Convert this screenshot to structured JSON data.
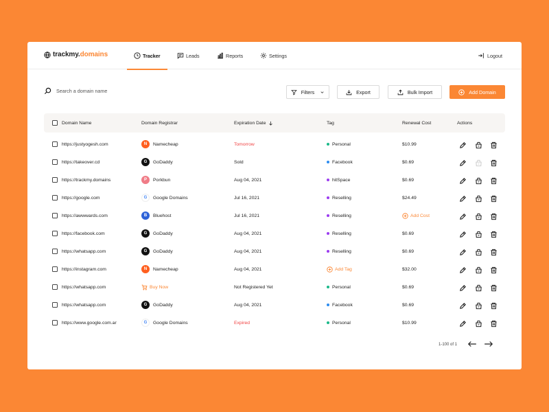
{
  "app": {
    "logo_part1": "trackmy.",
    "logo_part2": "domains"
  },
  "nav": {
    "tabs": [
      {
        "label": "Tracker",
        "icon": "clock-icon",
        "active": true
      },
      {
        "label": "Leads",
        "icon": "message-icon",
        "active": false
      },
      {
        "label": "Reports",
        "icon": "bar-chart-icon",
        "active": false
      },
      {
        "label": "Settings",
        "icon": "gear-icon",
        "active": false
      }
    ],
    "logout_label": "Logout"
  },
  "toolbar": {
    "search_placeholder": "Search a domain name",
    "filters_label": "Filters",
    "export_label": "Export",
    "bulk_import_label": "Bulk Import",
    "add_domain_label": "Add Domain"
  },
  "table": {
    "headers": {
      "domain": "Domain Name",
      "registrar": "Domain Registrar",
      "expiration": "Expiration Date",
      "tag": "Tag",
      "cost": "Renewal Cost",
      "actions": "Actions"
    },
    "rows": [
      {
        "domain": "https://justyogesh.com",
        "registrar": "Namecheap",
        "expiration": "Tomorrow",
        "tag": "Personal",
        "cost": "$10.99"
      },
      {
        "domain": "https://takeover.cd",
        "registrar": "GoDaddy",
        "expiration": "Sold",
        "tag": "Facebook",
        "cost": "$0.69"
      },
      {
        "domain": "https://trackmy.domains",
        "registrar": "Porkbun",
        "expiration": "Aug 04, 2021",
        "tag": "hitSpace",
        "cost": "$0.69"
      },
      {
        "domain": "https://google.com",
        "registrar": "Google Domains",
        "expiration": "Jul 16, 2021",
        "tag": "Reselling",
        "cost": "$24.49"
      },
      {
        "domain": "https://awwwards.com",
        "registrar": "Bluehost",
        "expiration": "Jul 16, 2021",
        "tag": "Reselling",
        "cost": "Add Cost"
      },
      {
        "domain": "https://facebook.com",
        "registrar": "GoDaddy",
        "expiration": "Aug 04, 2021",
        "tag": "Reselling",
        "cost": "$0.69"
      },
      {
        "domain": "https://whatsapp.com",
        "registrar": "GoDaddy",
        "expiration": "Aug 04, 2021",
        "tag": "Reselling",
        "cost": "$0.69"
      },
      {
        "domain": "https://instagram.com",
        "registrar": "Namecheap",
        "expiration": "Aug 04, 2021",
        "tag": "Add Tag",
        "cost": "$32.00"
      },
      {
        "domain": "https://whatsapp.com",
        "registrar": "Buy Now",
        "expiration": "Not Registered Yet",
        "tag": "Personal",
        "cost": "$0.69"
      },
      {
        "domain": "https://whatsapp.com",
        "registrar": "GoDaddy",
        "expiration": "Aug 04, 2021",
        "tag": "Facebook",
        "cost": "$0.69"
      },
      {
        "domain": "https://www.google.com.ar",
        "registrar": "Google Domains",
        "expiration": "Expired",
        "tag": "Personal",
        "cost": "$10.99"
      }
    ]
  },
  "pagination": {
    "label": "1-100 of 1"
  },
  "colors": {
    "accent": "#FB8734",
    "danger": "#F04343",
    "tag_personal": "#1BB98A",
    "tag_facebook": "#2D8CF0",
    "tag_hitspace": "#9B3CF0",
    "tag_reselling": "#9B3CF0"
  }
}
